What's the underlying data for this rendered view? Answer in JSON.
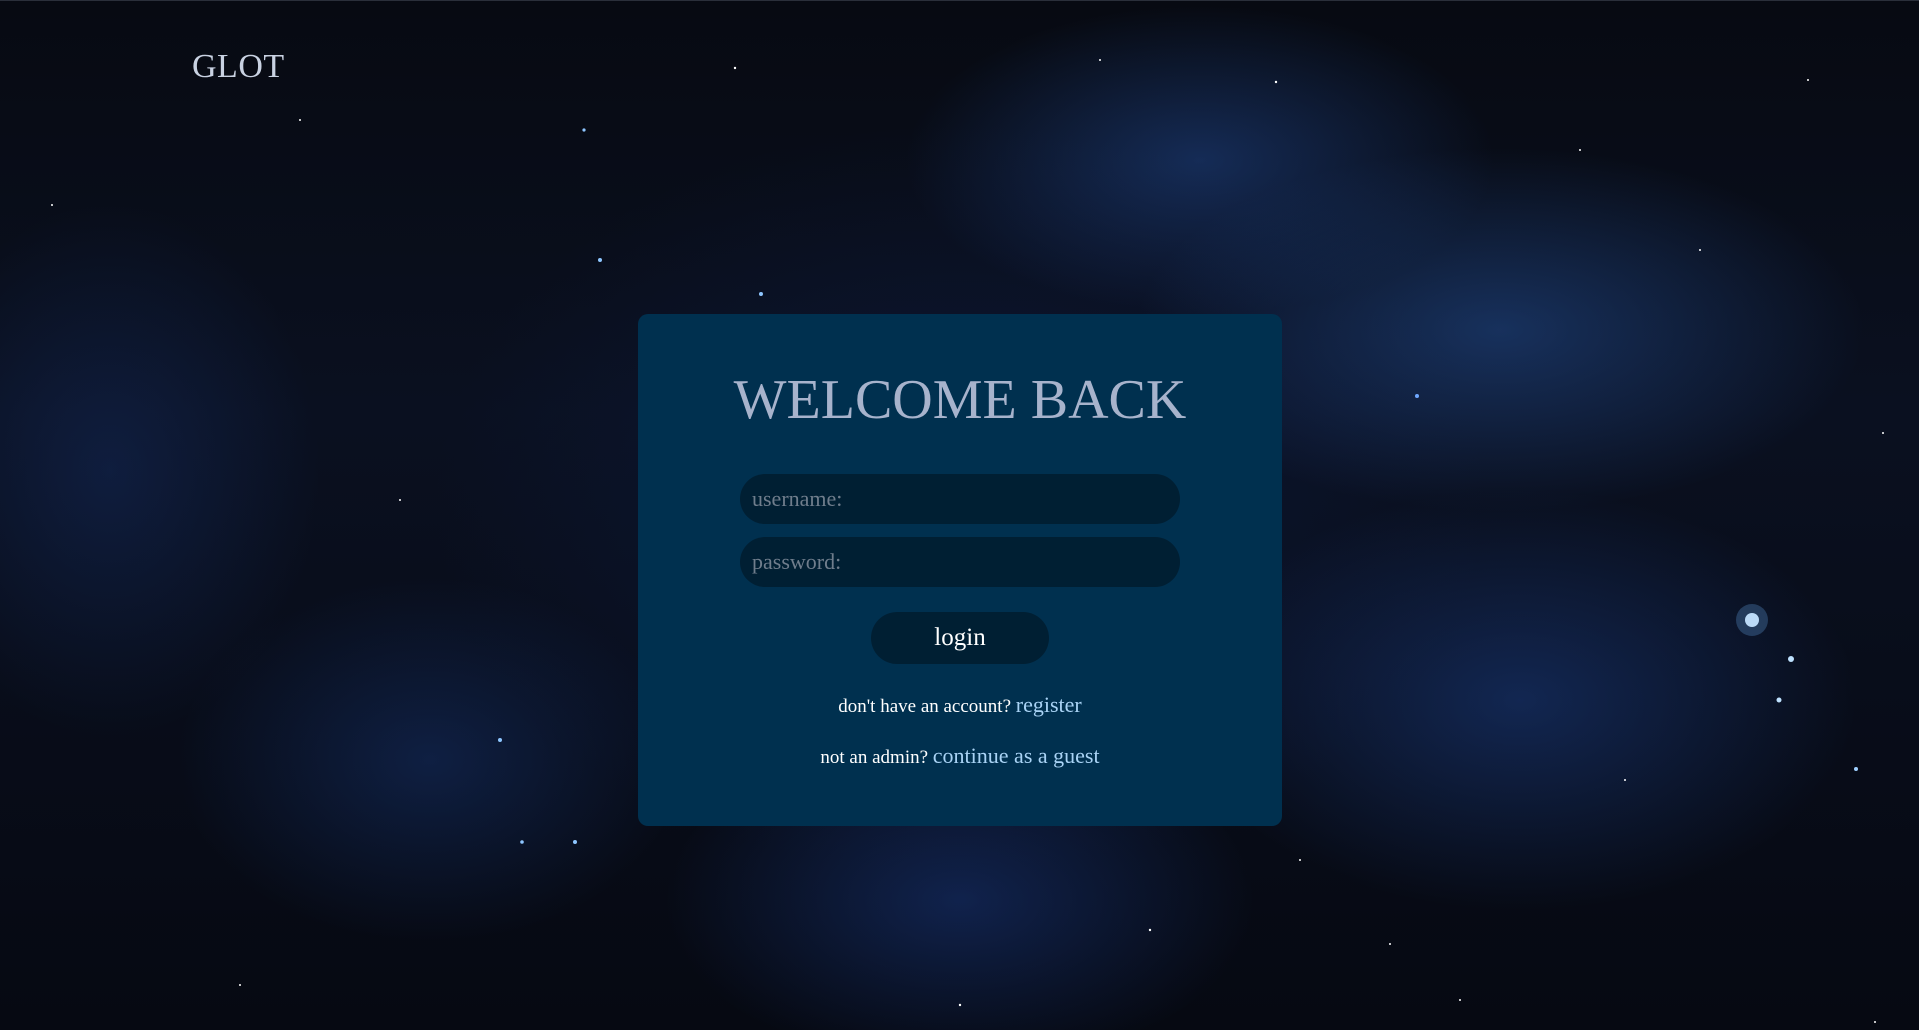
{
  "header": {
    "logo": "GLOT"
  },
  "login_card": {
    "title": "WELCOME BACK",
    "username_placeholder": "username:",
    "password_placeholder": "password:",
    "login_label": "login",
    "register_prompt": "don't have an account?",
    "register_link": "register",
    "guest_prompt": "not an admin?",
    "guest_link": "continue as a guest"
  },
  "colors": {
    "card_background": "#00304f",
    "field_background": "#001f33",
    "title_color": "#a7b3cc",
    "link_color": "#a9d3f5"
  }
}
